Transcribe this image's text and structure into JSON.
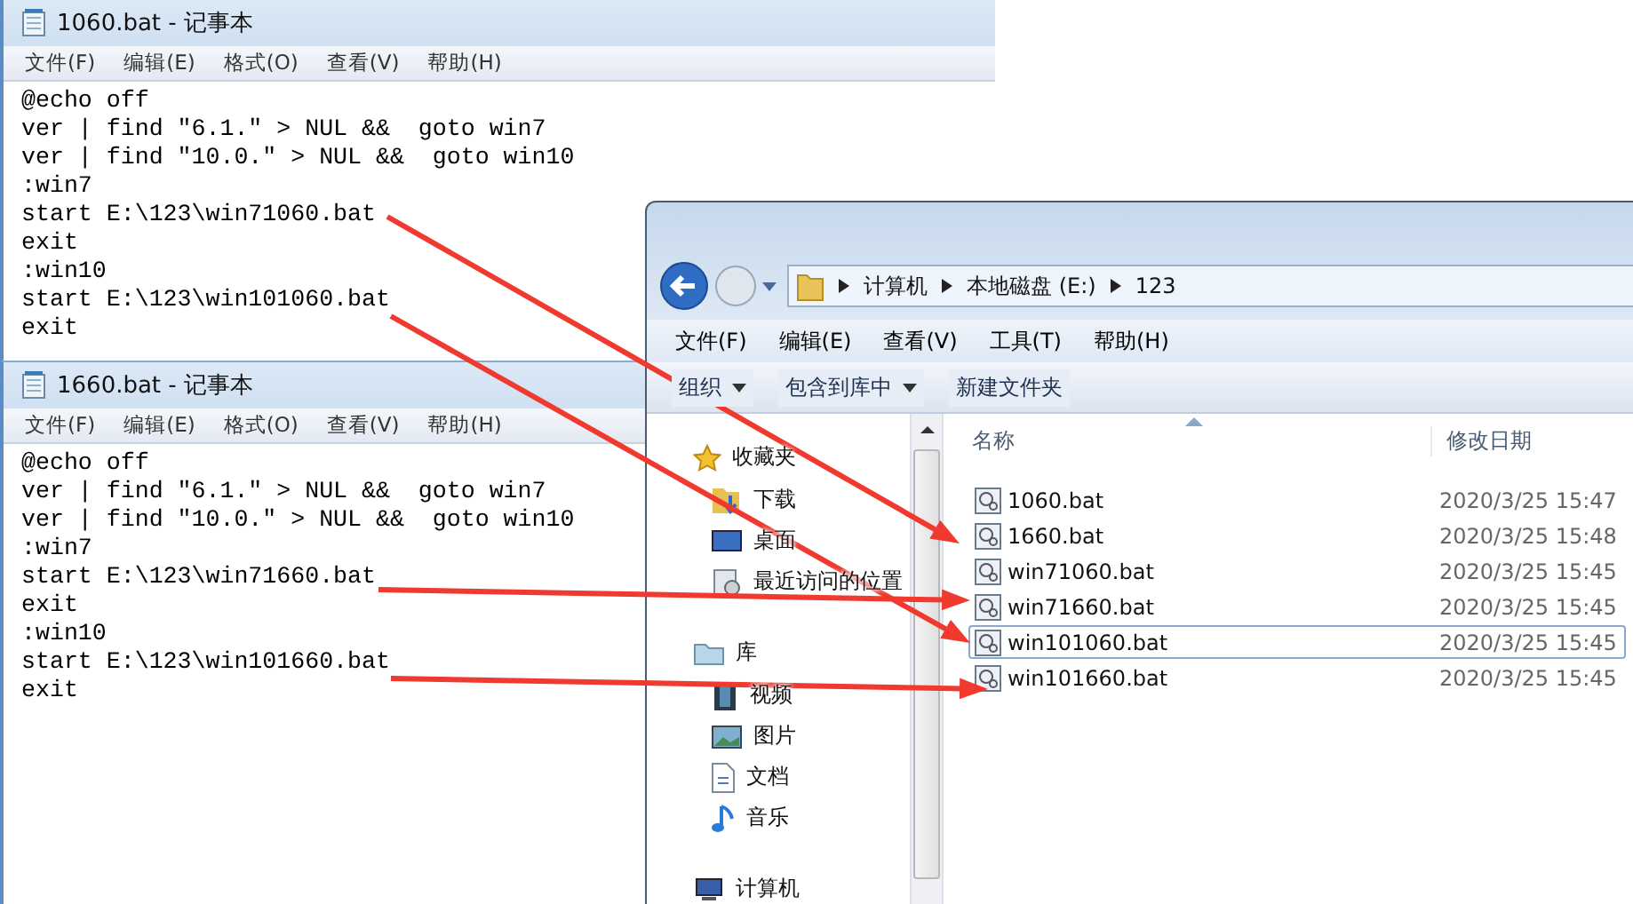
{
  "notepads": [
    {
      "title": "1060.bat - 记事本",
      "menu": [
        "文件(F)",
        "编辑(E)",
        "格式(O)",
        "查看(V)",
        "帮助(H)"
      ],
      "lines": [
        "@echo off",
        "ver | find \"6.1.\" > NUL &&  goto win7",
        "ver | find \"10.0.\" > NUL &&  goto win10",
        ":win7",
        "start E:\\123\\win71060.bat",
        "exit",
        ":win10",
        "start E:\\123\\win101060.bat",
        "exit"
      ]
    },
    {
      "title": "1660.bat - 记事本",
      "menu": [
        "文件(F)",
        "编辑(E)",
        "格式(O)",
        "查看(V)",
        "帮助(H)"
      ],
      "lines": [
        "@echo off",
        "ver | find \"6.1.\" > NUL &&  goto win7",
        "ver | find \"10.0.\" > NUL &&  goto win10",
        ":win7",
        "start E:\\123\\win71660.bat",
        "exit",
        ":win10",
        "start E:\\123\\win101660.bat",
        "exit"
      ]
    }
  ],
  "explorer": {
    "breadcrumb": [
      "计算机",
      "本地磁盘 (E:)",
      "123"
    ],
    "menu": [
      "文件(F)",
      "编辑(E)",
      "查看(V)",
      "工具(T)",
      "帮助(H)"
    ],
    "toolbar": [
      {
        "label": "组织",
        "dropdown": true
      },
      {
        "label": "包含到库中",
        "dropdown": true
      },
      {
        "label": "新建文件夹",
        "dropdown": false
      }
    ],
    "sidebar": [
      {
        "label": "收藏夹",
        "children": [
          {
            "label": "下载"
          },
          {
            "label": "桌面"
          },
          {
            "label": "最近访问的位置"
          }
        ]
      },
      {
        "label": "库",
        "children": [
          {
            "label": "视频"
          },
          {
            "label": "图片"
          },
          {
            "label": "文档"
          },
          {
            "label": "音乐"
          }
        ]
      },
      {
        "label": "计算机"
      }
    ],
    "columns": [
      "名称",
      "修改日期"
    ],
    "files": [
      {
        "name": "1060.bat",
        "modified": "2020/3/25 15:47",
        "selected": false
      },
      {
        "name": "1660.bat",
        "modified": "2020/3/25 15:48",
        "selected": false
      },
      {
        "name": "win71060.bat",
        "modified": "2020/3/25 15:45",
        "selected": false
      },
      {
        "name": "win71660.bat",
        "modified": "2020/3/25 15:45",
        "selected": false
      },
      {
        "name": "win101060.bat",
        "modified": "2020/3/25 15:45",
        "selected": true
      },
      {
        "name": "win101660.bat",
        "modified": "2020/3/25 15:45",
        "selected": false
      }
    ]
  }
}
